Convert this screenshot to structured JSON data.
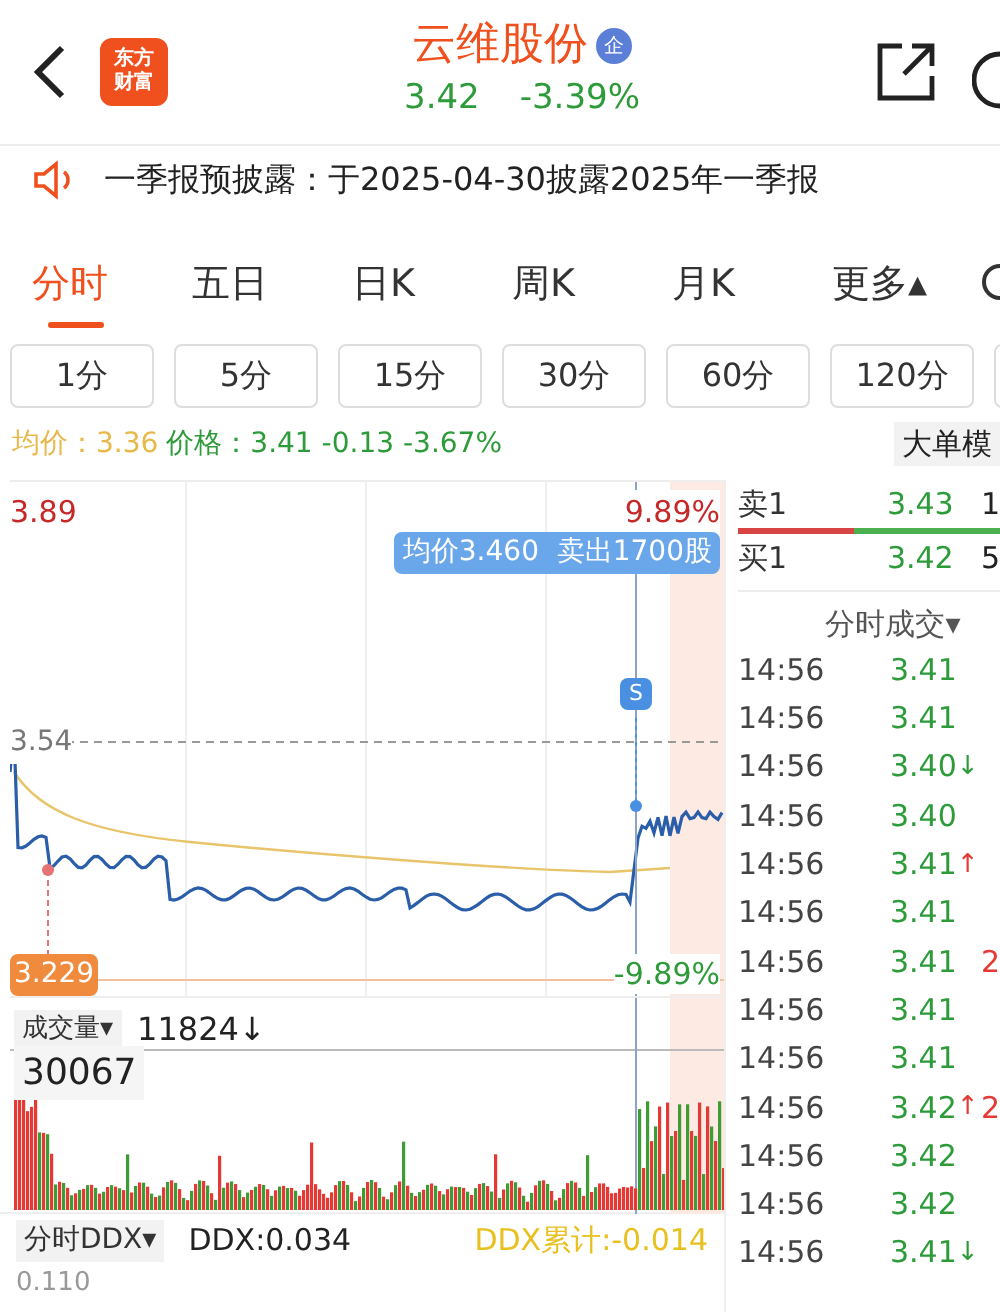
{
  "header": {
    "logo_lines": [
      "东方",
      "财富"
    ],
    "title": "云维股份",
    "badge": "企",
    "price": "3.42",
    "change": "-3.39%"
  },
  "notice": "一季报预披露：于2025-04-30披露2025年一季报",
  "tabs": [
    {
      "label": "分时",
      "selected": true
    },
    {
      "label": "五日",
      "selected": false
    },
    {
      "label": "日K",
      "selected": false
    },
    {
      "label": "周K",
      "selected": false
    },
    {
      "label": "月K",
      "selected": false
    },
    {
      "label": "更多▴",
      "selected": false
    }
  ],
  "periods": [
    "1分",
    "5分",
    "15分",
    "30分",
    "60分",
    "120分"
  ],
  "info": {
    "avg_label": "均价：",
    "avg_value": "3.36",
    "price_label": "价格：",
    "price": "3.41",
    "change": "-0.13",
    "pct": "-3.67%",
    "mode_button": "大单模"
  },
  "chart": {
    "high": "3.89",
    "high_pct": "9.89%",
    "tooltip": "均价3.460  卖出1700股",
    "prev_close": "3.54",
    "low_marker": "3.229",
    "low_pct": "-9.89%",
    "signal": "S"
  },
  "orderbook": [
    {
      "label": "卖1",
      "price": "3.43",
      "volume": "1"
    },
    {
      "label": "买1",
      "price": "3.42",
      "volume": "5"
    }
  ],
  "trades_header": "分时成交▾",
  "trades": [
    {
      "time": "14:56",
      "price": "3.41"
    },
    {
      "time": "14:56",
      "price": "3.41"
    },
    {
      "time": "14:56",
      "price": "3.40",
      "arrow": "↓",
      "rising": false
    },
    {
      "time": "14:56",
      "price": "3.40"
    },
    {
      "time": "14:56",
      "price": "3.41",
      "arrow": "↑",
      "rising": true
    },
    {
      "time": "14:56",
      "price": "3.41"
    },
    {
      "time": "14:56",
      "price": "3.41",
      "volume": "2"
    },
    {
      "time": "14:56",
      "price": "3.41"
    },
    {
      "time": "14:56",
      "price": "3.41"
    },
    {
      "time": "14:56",
      "price": "3.42",
      "arrow": "↑",
      "rising": true,
      "volume": "2"
    },
    {
      "time": "14:56",
      "price": "3.42"
    },
    {
      "time": "14:56",
      "price": "3.42"
    },
    {
      "time": "14:56",
      "price": "3.41",
      "arrow": "↓",
      "rising": false
    }
  ],
  "volume": {
    "label": "成交量▾",
    "value": "11824↓",
    "max": "30067"
  },
  "ddx": {
    "label": "分时DDX▾",
    "value": "DDX:0.034",
    "cumulative": "DDX累计:-0.014",
    "axis": "0.110"
  }
}
